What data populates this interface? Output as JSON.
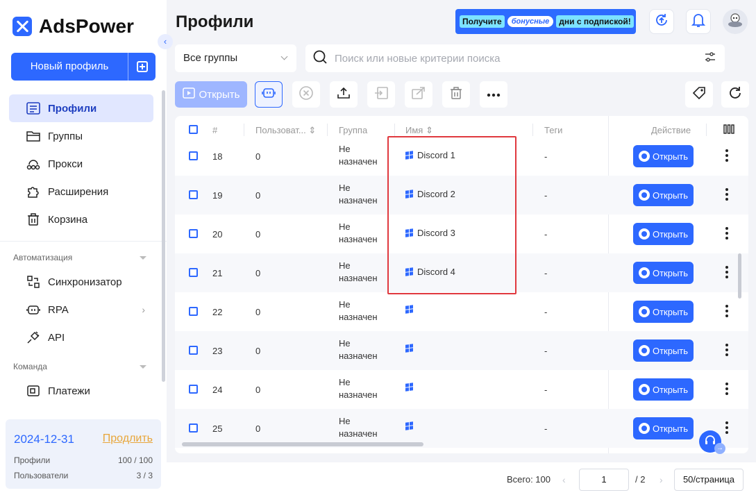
{
  "app": {
    "name": "AdsPower"
  },
  "sidebar": {
    "new_profile_label": "Новый профиль",
    "items": [
      {
        "label": "Профили",
        "icon": "profiles-list-icon",
        "active": true
      },
      {
        "label": "Группы",
        "icon": "folder-icon"
      },
      {
        "label": "Прокси",
        "icon": "proxy-network-icon"
      },
      {
        "label": "Расширения",
        "icon": "puzzle-icon"
      },
      {
        "label": "Корзина",
        "icon": "trash-icon"
      }
    ],
    "automation_label": "Автоматизация",
    "automation_items": [
      {
        "label": "Синхронизатор",
        "icon": "sync-icon"
      },
      {
        "label": "RPA",
        "icon": "robot-icon"
      },
      {
        "label": "API",
        "icon": "plug-icon"
      }
    ],
    "team_label": "Команда",
    "team_items": [
      {
        "label": "Платежи",
        "icon": "wallet-icon"
      }
    ]
  },
  "plan": {
    "expiry": "2024-12-31",
    "renew_label": "Продлить",
    "profiles_label": "Профили",
    "profiles_value": "100 / 100",
    "users_label": "Пользователи",
    "users_value": "3 / 3"
  },
  "header": {
    "title": "Профили",
    "promo": {
      "part1": "Получите",
      "part2": "бонусные",
      "part3": "дни с подпиской!"
    }
  },
  "filters": {
    "group_select": "Все группы",
    "search_placeholder": "Поиск или новые критерии поиска"
  },
  "toolbar": {
    "open_label": "Открыть"
  },
  "table": {
    "columns": {
      "num": "#",
      "users": "Пользоват...",
      "group": "Группа",
      "name": "Имя",
      "tags": "Теги",
      "action": "Действие"
    },
    "open_label": "Открыть",
    "rows": [
      {
        "num": "18",
        "users": "0",
        "group": "Не назначен",
        "name": "Discord 1",
        "tags": "-"
      },
      {
        "num": "19",
        "users": "0",
        "group": "Не назначен",
        "name": "Discord 2",
        "tags": "-"
      },
      {
        "num": "20",
        "users": "0",
        "group": "Не назначен",
        "name": "Discord 3",
        "tags": "-"
      },
      {
        "num": "21",
        "users": "0",
        "group": "Не назначен",
        "name": "Discord 4",
        "tags": "-"
      },
      {
        "num": "22",
        "users": "0",
        "group": "Не назначен",
        "name": "",
        "tags": "-"
      },
      {
        "num": "23",
        "users": "0",
        "group": "Не назначен",
        "name": "",
        "tags": "-"
      },
      {
        "num": "24",
        "users": "0",
        "group": "Не назначен",
        "name": "",
        "tags": "-"
      },
      {
        "num": "25",
        "users": "0",
        "group": "Не назначен",
        "name": "",
        "tags": "-"
      }
    ]
  },
  "pagination": {
    "total": "Всего: 100",
    "current_page": "1",
    "total_pages": "/ 2",
    "page_size": "50/страница"
  },
  "colors": {
    "accent": "#2d68ff",
    "highlight": "#e0383e",
    "renew": "#e8a63a"
  }
}
